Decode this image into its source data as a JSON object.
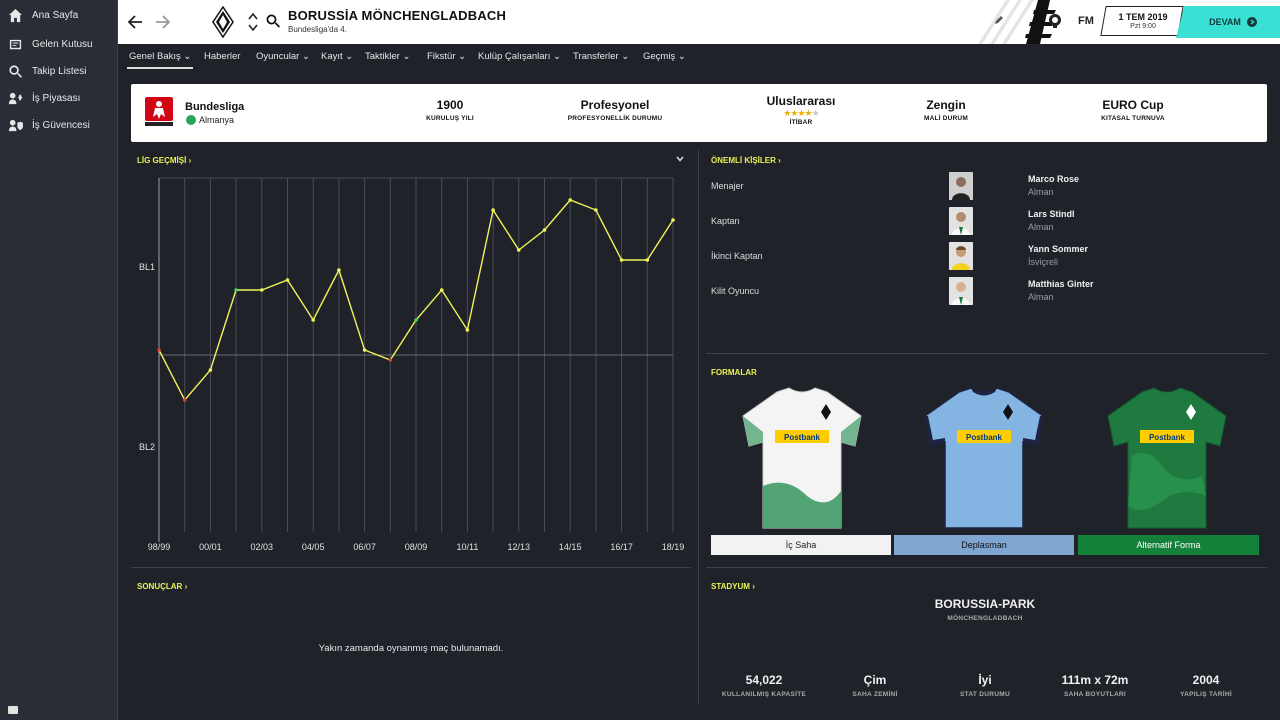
{
  "sidebar": {
    "items": [
      {
        "label": "Ana Sayfa",
        "icon": "home-icon"
      },
      {
        "label": "Gelen Kutusu",
        "icon": "inbox-icon"
      },
      {
        "label": "Takip Listesi",
        "icon": "search-icon"
      },
      {
        "label": "İş Piyasası",
        "icon": "job-market-icon"
      },
      {
        "label": "İş Güvencesi",
        "icon": "job-security-icon"
      }
    ]
  },
  "header": {
    "club_name": "BORUSSİA MÖNCHENGLADBACH",
    "club_subtitle": "Bundesliga'da 4.",
    "fm_label": "FM",
    "date": "1 TEM 2019",
    "day_time": "Pzt 9:00",
    "continue_label": "DEVAM"
  },
  "tabs": [
    {
      "label": "Genel Bakış",
      "active": true
    },
    {
      "label": "Haberler"
    },
    {
      "label": "Oyuncular"
    },
    {
      "label": "Kayıt"
    },
    {
      "label": "Taktikler"
    },
    {
      "label": "Fikstür"
    },
    {
      "label": "Kulüp Çalışanları"
    },
    {
      "label": "Transferler"
    },
    {
      "label": "Geçmiş"
    }
  ],
  "info": {
    "league": "Bundesliga",
    "country": "Almanya",
    "founded": {
      "value": "1900",
      "label": "KURULUŞ YILI"
    },
    "status": {
      "value": "Profesyonel",
      "label": "PROFESYONELLİK DURUMU"
    },
    "reputation": {
      "value": "Uluslararası",
      "label": "İTİBAR",
      "stars": 4,
      "max_stars": 5
    },
    "finances": {
      "value": "Zengin",
      "label": "MALİ DURUM"
    },
    "continental": {
      "value": "EURO Cup",
      "label": "KITASAL TURNUVA"
    }
  },
  "league_history": {
    "title": "LİG GEÇMİŞİ",
    "chart_data": {
      "type": "line",
      "x_tick_labels": [
        "98/99",
        "00/01",
        "02/03",
        "04/05",
        "06/07",
        "08/09",
        "10/11",
        "12/13",
        "14/15",
        "16/17",
        "18/19"
      ],
      "y_tick_labels": [
        "BL1",
        "BL2"
      ],
      "x": [
        "98/99",
        "99/00",
        "00/01",
        "01/02",
        "02/03",
        "03/04",
        "04/05",
        "05/06",
        "06/07",
        "07/08",
        "08/09",
        "09/10",
        "10/11",
        "11/12",
        "12/13",
        "13/14",
        "14/15",
        "15/16",
        "16/17",
        "17/18",
        "18/19"
      ],
      "note_y": "overall league position (BL1 positions 1-18, BL2 positions 19+)",
      "values": [
        18,
        23,
        20,
        12,
        12,
        11,
        15,
        10,
        18,
        19,
        15,
        12,
        16,
        4,
        8,
        6,
        3,
        4,
        9,
        9,
        5
      ],
      "ylim": [
        1,
        36
      ],
      "grid": true
    }
  },
  "key_people": {
    "title": "ÖNEMLİ KİŞİLER",
    "rows": [
      {
        "role": "Menajer",
        "name": "Marco Rose",
        "nationality": "Alman"
      },
      {
        "role": "Kaptan",
        "name": "Lars Stindl",
        "nationality": "Alman"
      },
      {
        "role": "İkinci Kaptan",
        "name": "Yann Sommer",
        "nationality": "İsviçreli"
      },
      {
        "role": "Kilit Oyuncu",
        "name": "Matthias Ginter",
        "nationality": "Alman"
      }
    ]
  },
  "kits": {
    "title": "FORMALAR",
    "sponsor": "Postbank",
    "items": [
      {
        "label": "İç Saha",
        "button_color": "#f2f2f2",
        "text_color": "#222222"
      },
      {
        "label": "Deplasman",
        "button_color": "#7fa6d0",
        "text_color": "#111111"
      },
      {
        "label": "Alternatif Forma",
        "button_color": "#14813a",
        "text_color": "#ffffff"
      }
    ]
  },
  "results": {
    "title": "SONUÇLAR",
    "empty_text": "Yakın zamanda oynanmış maç bulunamadı."
  },
  "stadium": {
    "title": "STADYUM",
    "name": "BORUSSIA-PARK",
    "city": "MÖNCHENGLADBACH",
    "stats": [
      {
        "value": "54,022",
        "label": "KULLANILMIŞ KAPASİTE"
      },
      {
        "value": "Çim",
        "label": "SAHA ZEMİNİ"
      },
      {
        "value": "İyi",
        "label": "STAT DURUMU"
      },
      {
        "value": "111m x 72m",
        "label": "SAHA BOYUTLARI"
      },
      {
        "value": "2004",
        "label": "YAPILIŞ TARİHİ"
      }
    ]
  },
  "colors": {
    "accent_yellow": "#e9f259",
    "continue_teal": "#39e0d3",
    "background": "#1f2228",
    "panel_white": "#ffffff"
  }
}
